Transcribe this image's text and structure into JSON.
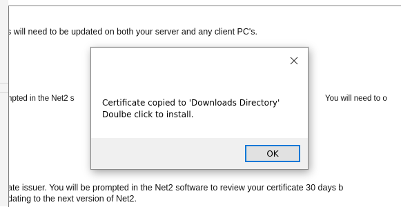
{
  "background_document": {
    "lines": [
      "s will need to be updated on both your server and any client PC's.",
      "npted in the Net2 s",
      "You will need to o",
      "ate issuer. You will be prompted in the Net2 software to review your certificate 30 days b",
      "dating to the next version of Net2."
    ]
  },
  "dialog": {
    "message_line1": "Certificate copied to 'Downloads Directory'",
    "message_line2": "Doulbe click to install.",
    "ok_label": "OK",
    "close_icon": "close-icon"
  },
  "colors": {
    "dialog_footer": "#f0f0f0",
    "button_focus_border": "#0078d7",
    "button_face": "#e1e1e1"
  }
}
